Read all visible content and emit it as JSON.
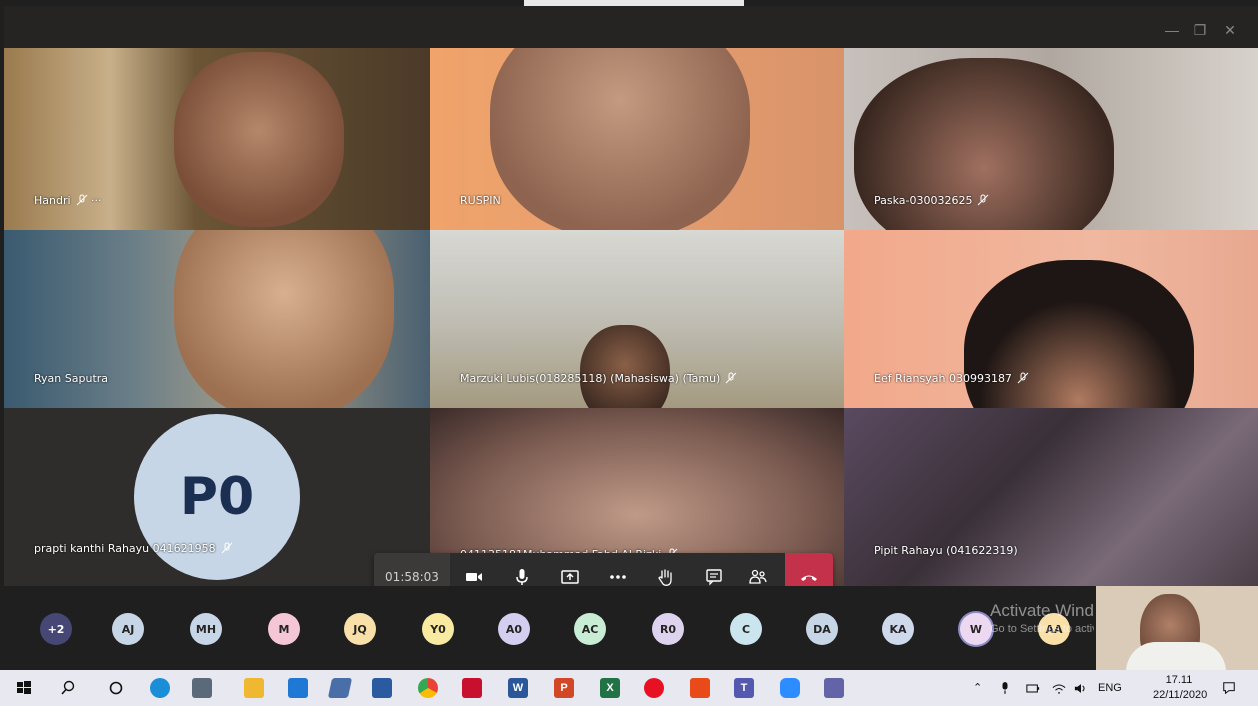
{
  "window": {
    "minimize_label": "—",
    "maximize_label": "❐",
    "close_label": "✕"
  },
  "tiles": [
    {
      "name": "Handri",
      "muted": true,
      "more": "···"
    },
    {
      "name": "RUSPIN",
      "muted": false
    },
    {
      "name": "Paska-030032625",
      "muted": true
    },
    {
      "name": "Ryan Saputra",
      "muted": false
    },
    {
      "name": "Marzuki Lubis(018285118) (Mahasiswa) (Tamu)",
      "muted": true
    },
    {
      "name": "Eef Riansyah 030993187",
      "muted": true
    },
    {
      "name": "prapti kanthi Rahayu 041621958",
      "muted": true,
      "initials": "P0",
      "avatar_color": "#c7d6e6"
    },
    {
      "name": "041135181Muhammad Fahd Al Rizki",
      "muted": true
    },
    {
      "name": "Pipit Rahayu (041622319)",
      "muted": false
    }
  ],
  "call_controls": {
    "timer": "01:58:03",
    "buttons": [
      "camera",
      "microphone",
      "share",
      "more",
      "raise-hand",
      "chat",
      "participants"
    ],
    "hangup": "leave"
  },
  "participants_strip": [
    {
      "initials": "+2",
      "color": "#464775",
      "text_color": "#ffffff"
    },
    {
      "initials": "AJ",
      "color": "#c7d6e6"
    },
    {
      "initials": "MH",
      "color": "#c7d6e6"
    },
    {
      "initials": "M",
      "color": "#f5c6d6"
    },
    {
      "initials": "JQ",
      "color": "#f8e0a8"
    },
    {
      "initials": "Y0",
      "color": "#f8eaa0"
    },
    {
      "initials": "A0",
      "color": "#d4cff0"
    },
    {
      "initials": "AC",
      "color": "#c9ecd5"
    },
    {
      "initials": "R0",
      "color": "#ddd3ef"
    },
    {
      "initials": "C",
      "color": "#cbe5ee"
    },
    {
      "initials": "DA",
      "color": "#c7d6e6"
    },
    {
      "initials": "KA",
      "color": "#cfd9ec"
    },
    {
      "initials": "W",
      "color": "#ecd8f0"
    },
    {
      "initials": "AA",
      "color": "#f8e0a8"
    }
  ],
  "watermark": {
    "title": "Activate Windows",
    "subtitle": "Go to Settings to activate Windows."
  },
  "taskbar": {
    "apps": [
      "windows-start",
      "search",
      "cortana",
      "edge",
      "file-explorer",
      "file-manager",
      "mail",
      "notes",
      "store",
      "chrome",
      "app-red",
      "word",
      "powerpoint",
      "excel",
      "media",
      "app-orange",
      "teams",
      "zoom",
      "app-pinned"
    ],
    "language": "ENG",
    "time": "17.11",
    "date": "22/11/2020"
  }
}
